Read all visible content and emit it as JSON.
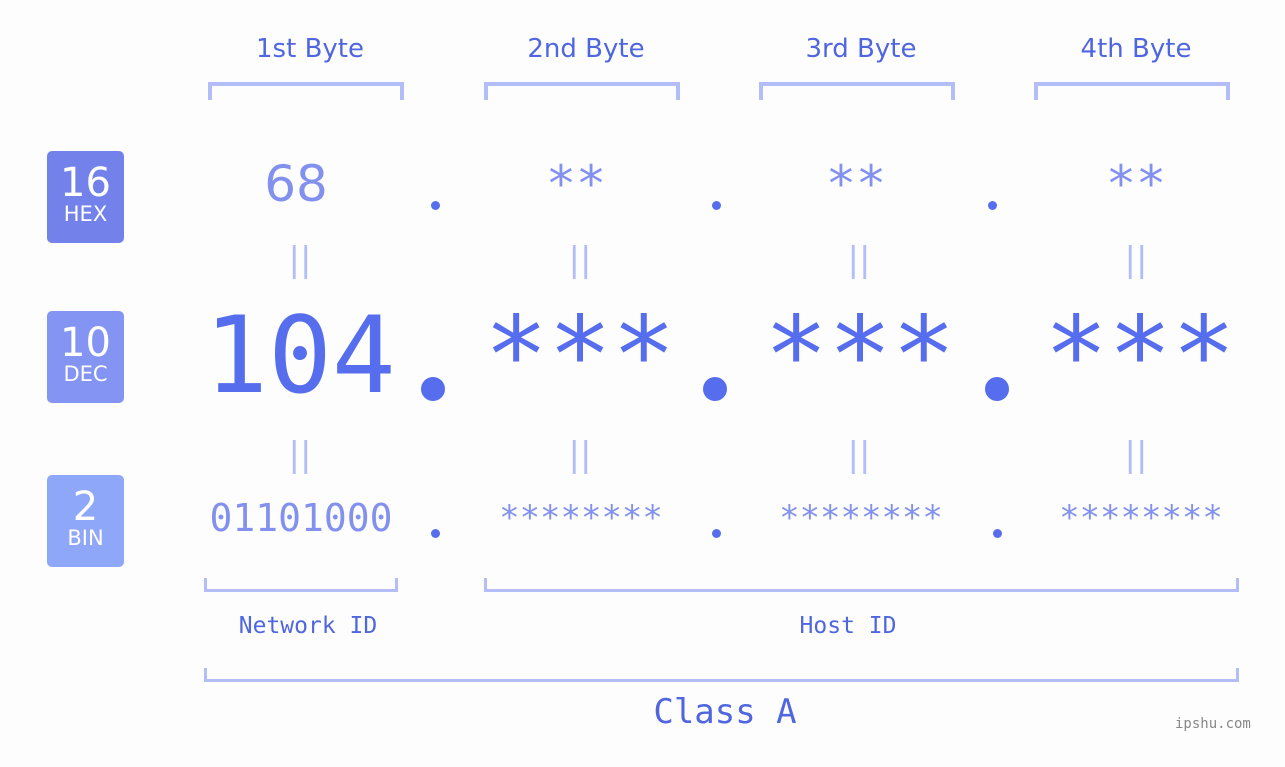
{
  "bytes": [
    {
      "header": "1st Byte",
      "hex": "68",
      "dec": "104",
      "bin": "01101000"
    },
    {
      "header": "2nd Byte",
      "hex": "**",
      "dec": "***",
      "bin": "********"
    },
    {
      "header": "3rd Byte",
      "hex": "**",
      "dec": "***",
      "bin": "********"
    },
    {
      "header": "4th Byte",
      "hex": "**",
      "dec": "***",
      "bin": "********"
    }
  ],
  "bases": {
    "hex": {
      "num": "16",
      "label": "HEX",
      "color": "#7382ea"
    },
    "dec": {
      "num": "10",
      "label": "DEC",
      "color": "#8394f2"
    },
    "bin": {
      "num": "2",
      "label": "BIN",
      "color": "#8fa7f8"
    }
  },
  "equals_symbol": "||",
  "network_id_label": "Network ID",
  "host_id_label": "Host ID",
  "class_label": "Class A",
  "watermark": "ipshu.com",
  "colors": {
    "accent": "#566ded",
    "light": "#8391ee",
    "bracket": "#b3bdf8"
  }
}
